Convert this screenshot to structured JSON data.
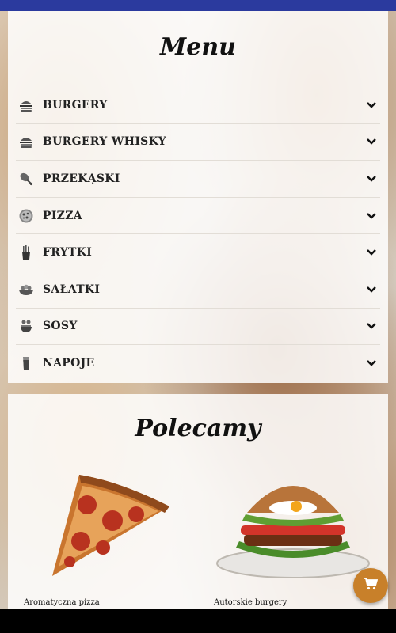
{
  "menu": {
    "title": "Menu",
    "items": [
      {
        "label": "BURGERY",
        "icon": "burger-icon"
      },
      {
        "label": "BURGERY WHISKY",
        "icon": "burger-whisky-icon"
      },
      {
        "label": "PRZEKĄSKI",
        "icon": "drumstick-icon"
      },
      {
        "label": "PIZZA",
        "icon": "pizza-icon"
      },
      {
        "label": "FRYTKI",
        "icon": "fries-icon"
      },
      {
        "label": "SAŁATKI",
        "icon": "salad-icon"
      },
      {
        "label": "SOSY",
        "icon": "sauce-icon"
      },
      {
        "label": "NAPOJE",
        "icon": "drink-icon"
      }
    ]
  },
  "recommended": {
    "title": "Polecamy",
    "items": [
      {
        "caption": "Aromatyczna pizza",
        "image": "pizza-slice-image"
      },
      {
        "caption": "Autorskie burgery",
        "image": "burger-image"
      }
    ]
  },
  "colors": {
    "top_bar": "#2b3a9e",
    "cart_button": "#c8802a"
  },
  "cart": {
    "icon": "cart-icon"
  }
}
